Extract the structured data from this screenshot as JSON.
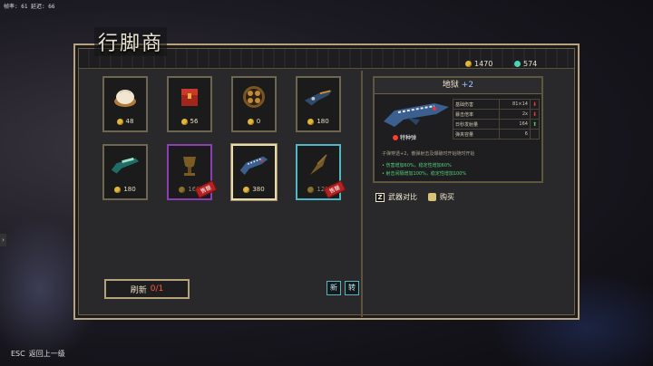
{
  "hud": {
    "fps": "帧率: 61  延迟: 66"
  },
  "shop": {
    "title": "行脚商"
  },
  "currency": {
    "coins": "1470",
    "gems": "574"
  },
  "items": [
    {
      "name": "dumpling-icon",
      "price": "48"
    },
    {
      "name": "red-chest-icon",
      "price": "56"
    },
    {
      "name": "bronze-orb-icon",
      "price": "0"
    },
    {
      "name": "dragon-gun-icon",
      "price": "180"
    },
    {
      "name": "green-blaster-icon",
      "price": "180"
    },
    {
      "name": "golden-cup-icon",
      "price": "168",
      "sold": "售罄"
    },
    {
      "name": "shark-gun-icon",
      "price": "380"
    },
    {
      "name": "arrowhead-icon",
      "price": "129",
      "sold": "售罄"
    }
  ],
  "refresh": {
    "label": "刷新",
    "count": "0/1"
  },
  "sort_buttons": [
    "新",
    "转"
  ],
  "detail": {
    "name": "地狱",
    "level": "+2",
    "badge": "特种弹",
    "stats": [
      {
        "label": "基础伤害",
        "value": "81×14",
        "trend": "down"
      },
      {
        "label": "暴击倍率",
        "value": "2x",
        "trend": "down"
      },
      {
        "label": "日秒发射量",
        "value": "164",
        "trend": "up"
      },
      {
        "label": "弹夹容量",
        "value": "6",
        "trend": ""
      }
    ],
    "description": "子弹穿透+2，散弹射击及爆破时开始随时开始",
    "perks": [
      "• 伤害增加60%，稳定性增加60%",
      "• 射击间隔增加100%，稳定性增加100%"
    ]
  },
  "actions": {
    "compare_key": "Z",
    "compare_label": "武器对比",
    "buy_label": "购买"
  },
  "footer": {
    "esc_key": "ESC",
    "esc_label": "返回上一级"
  },
  "colors": {
    "coin": "#e2b63c",
    "gem": "#4cd3b5",
    "sold": "#b22222",
    "rare_purple": "#8a3fb3",
    "rare_cyan": "#4fb8c4"
  }
}
